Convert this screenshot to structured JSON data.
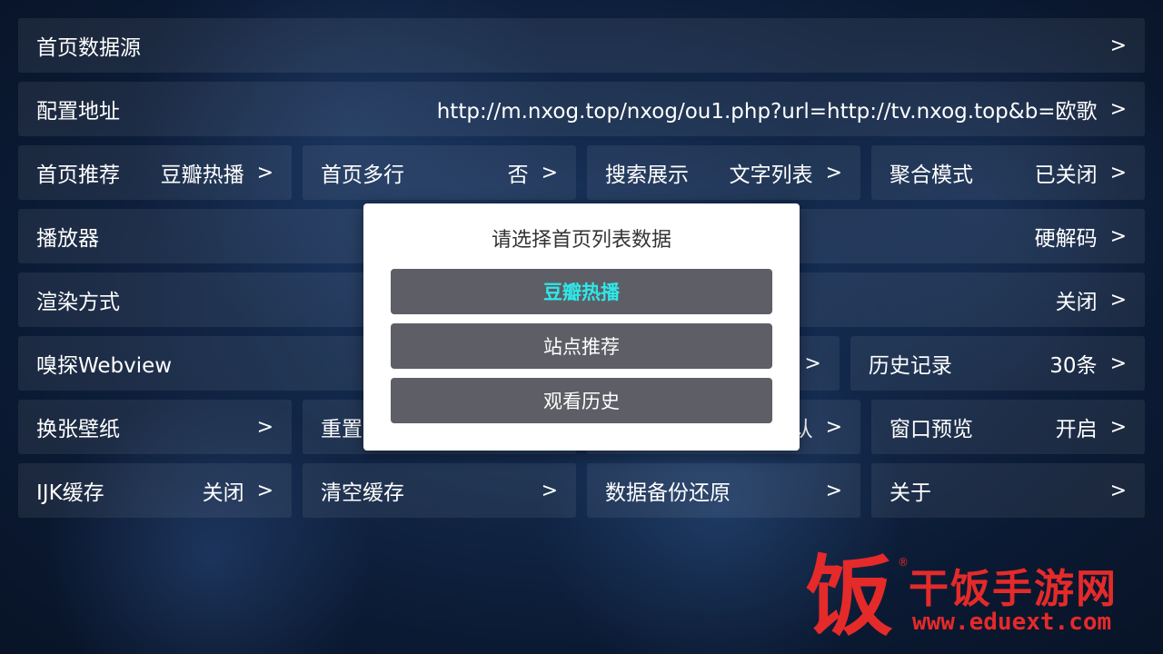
{
  "settings": {
    "home_source": {
      "label": "首页数据源",
      "arrow": ">"
    },
    "config_url": {
      "label": "配置地址",
      "value": "http://m.nxog.top/nxog/ou1.php?url=http://tv.nxog.top&b=欧歌",
      "arrow": ">"
    },
    "row3": [
      {
        "label": "首页推荐",
        "value": "豆瓣热播",
        "arrow": ">"
      },
      {
        "label": "首页多行",
        "value": "否",
        "arrow": ">"
      },
      {
        "label": "搜索展示",
        "value": "文字列表",
        "arrow": ">"
      },
      {
        "label": "聚合模式",
        "value": "已关闭",
        "arrow": ">"
      }
    ],
    "player": {
      "label": "播放器",
      "value": "硬解码",
      "arrow": ">"
    },
    "render": {
      "label": "渲染方式",
      "value": "关闭",
      "arrow": ">"
    },
    "row6": [
      {
        "label": "嗅探Webview",
        "arrow": ">"
      },
      {
        "label": "历史记录",
        "value": "30条",
        "arrow": ">"
      }
    ],
    "row7": [
      {
        "label": "换张壁纸",
        "arrow": ">"
      },
      {
        "label": "重置",
        "arrow": ""
      },
      {
        "label": "",
        "value": "认",
        "arrow": ">"
      },
      {
        "label": "窗口预览",
        "value": "开启",
        "arrow": ">"
      }
    ],
    "row8": [
      {
        "label": "IJK缓存",
        "value": "关闭",
        "arrow": ">"
      },
      {
        "label": "清空缓存",
        "arrow": ">"
      },
      {
        "label": "数据备份还原",
        "arrow": ">"
      },
      {
        "label": "关于",
        "arrow": ">"
      }
    ]
  },
  "dialog": {
    "title": "请选择首页列表数据",
    "options": [
      "豆瓣热播",
      "站点推荐",
      "观看历史"
    ],
    "selected_index": 0,
    "selected_color": "#2ee8e8"
  },
  "watermark": {
    "logo_char": "饭",
    "registered": "®",
    "name": "干饭手游网",
    "url": "www.eduext.com",
    "color": "#e52a2a"
  }
}
